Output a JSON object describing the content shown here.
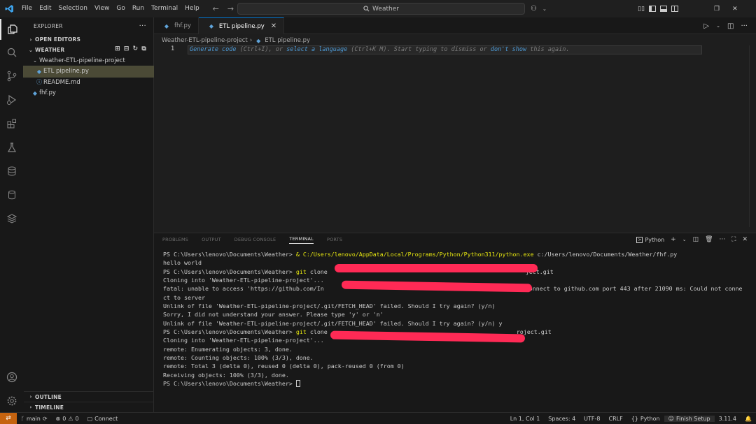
{
  "menu": [
    "File",
    "Edit",
    "Selection",
    "View",
    "Go",
    "Run",
    "Terminal",
    "Help"
  ],
  "command_center": {
    "label": "Weather",
    "icon": "search-icon"
  },
  "sidebar": {
    "title": "EXPLORER",
    "open_editors": "OPEN EDITORS",
    "workspace": "WEATHER",
    "folder": "Weather-ETL-pipeline-project",
    "files": [
      {
        "name": "ETL pipeline.py",
        "icon": "python-file-icon",
        "selected": true
      },
      {
        "name": "README.md",
        "icon": "info-icon",
        "selected": false
      }
    ],
    "root_file": "fhf.py",
    "outline": "OUTLINE",
    "timeline": "TIMELINE"
  },
  "tabs": [
    {
      "label": "fhf.py",
      "active": false
    },
    {
      "label": "ETL pipeline.py",
      "active": true
    }
  ],
  "breadcrumb": {
    "folder": "Weather-ETL-pipeline-project",
    "file": "ETL pipeline.py"
  },
  "editor": {
    "line_number": "1",
    "hint_parts": {
      "a": "Generate code",
      "b": " (Ctrl+I), or ",
      "c": "select a language",
      "d": " (Ctrl+K M). Start typing to dismiss or ",
      "e": "don't show",
      "f": " this again."
    }
  },
  "panel": {
    "tabs": [
      "PROBLEMS",
      "OUTPUT",
      "DEBUG CONSOLE",
      "TERMINAL",
      "PORTS"
    ],
    "active_tab": "TERMINAL",
    "terminal_name": "Python",
    "lines": {
      "l1_prompt": "PS C:\\Users\\lenovo\\Documents\\Weather> ",
      "l1_cmd": "& C:/Users/lenovo/AppData/Local/Programs/Python/Python311/python.exe",
      "l1_arg": " c:/Users/lenovo/Documents/Weather/fhf.py",
      "l2": "hello world",
      "l3_prompt": "PS C:\\Users\\lenovo\\Documents\\Weather> ",
      "l3_cmd": "git",
      "l3_rest": " clone",
      "l3_tail": "ject.git",
      "l4": "Cloning into 'Weather-ETL-pipeline-project'...",
      "l5_head": "fatal: unable to access 'https://github.com/In",
      "l5_tail": "connect to github.com port 443 after 21090 ms: Could not conne",
      "l6": "ct to server",
      "l7": "Unlink of file 'Weather-ETL-pipeline-project/.git/FETCH_HEAD' failed. Should I try again? (y/n)",
      "l8": "Sorry, I did not understand your answer. Please type 'y' or 'n'",
      "l9": "Unlink of file 'Weather-ETL-pipeline-project/.git/FETCH_HEAD' failed. Should I try again? (y/n) y",
      "l10_prompt": "PS C:\\Users\\lenovo\\Documents\\Weather> ",
      "l10_cmd": "git",
      "l10_rest": " clone",
      "l10_tail": "roject.git",
      "l11": "Cloning into 'Weather-ETL-pipeline-project'...",
      "l12": "remote: Enumerating objects: 3, done.",
      "l13": "remote: Counting objects: 100% (3/3), done.",
      "l14": "remote: Total 3 (delta 0), reused 0 (delta 0), pack-reused 0 (from 0)",
      "l15": "Receiving objects: 100% (3/3), done.",
      "l16": "PS C:\\Users\\lenovo\\Documents\\Weather> "
    }
  },
  "statusbar": {
    "branch": "main",
    "errors": "0",
    "warnings": "0",
    "connect": "Connect",
    "position": "Ln 1, Col 1",
    "spaces": "Spaces: 4",
    "encoding": "UTF-8",
    "eol": "CRLF",
    "language": "Python",
    "finish_setup": "Finish Setup",
    "python_version": "3.11.4"
  },
  "colors": {
    "accent": "#0078d4",
    "remote_indicator": "#c5630f",
    "redaction": "#ff2a55",
    "terminal_command": "#e5e510"
  }
}
